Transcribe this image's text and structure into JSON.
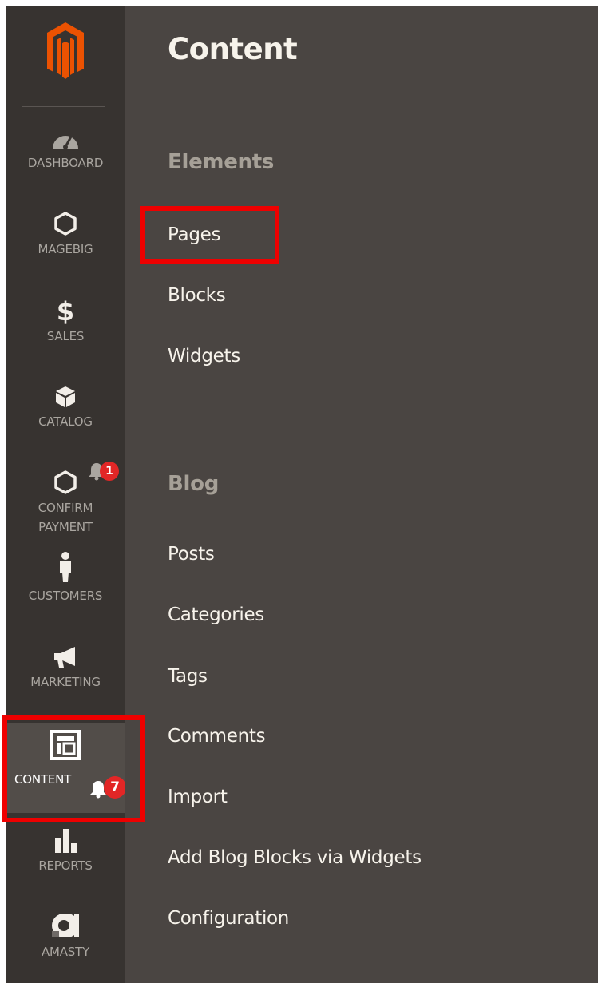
{
  "nav": {
    "items": [
      {
        "label": "DASHBOARD"
      },
      {
        "label": "MAGEBIG"
      },
      {
        "label": "SALES"
      },
      {
        "label": "CATALOG"
      },
      {
        "label": "CONFIRM\nPAYMENT",
        "badge": "1"
      },
      {
        "label": "CUSTOMERS"
      },
      {
        "label": "MARKETING"
      },
      {
        "label": "CONTENT",
        "badge": "7",
        "active": true
      },
      {
        "label": "REPORTS"
      },
      {
        "label": "AMASTY"
      }
    ]
  },
  "panel": {
    "title": "Content",
    "sections": [
      {
        "title": "Elements",
        "links": [
          "Pages",
          "Blocks",
          "Widgets"
        ]
      },
      {
        "title": "Blog",
        "links": [
          "Posts",
          "Categories",
          "Tags",
          "Comments",
          "Import",
          "Add Blog Blocks via Widgets",
          "Configuration"
        ]
      }
    ]
  },
  "colors": {
    "nav_bg": "#373330",
    "panel_bg": "#4a4542",
    "brand": "#eb5202",
    "badge": "#e22626",
    "highlight": "#ee0000"
  },
  "icons": [
    "magento-logo",
    "dashboard-gauge-icon",
    "hexagon-icon",
    "dollar-icon",
    "box-icon",
    "hexagon-icon",
    "bell-icon",
    "person-icon",
    "megaphone-icon",
    "layout-icon",
    "bell-icon",
    "bar-chart-icon",
    "amasty-logo-icon"
  ]
}
